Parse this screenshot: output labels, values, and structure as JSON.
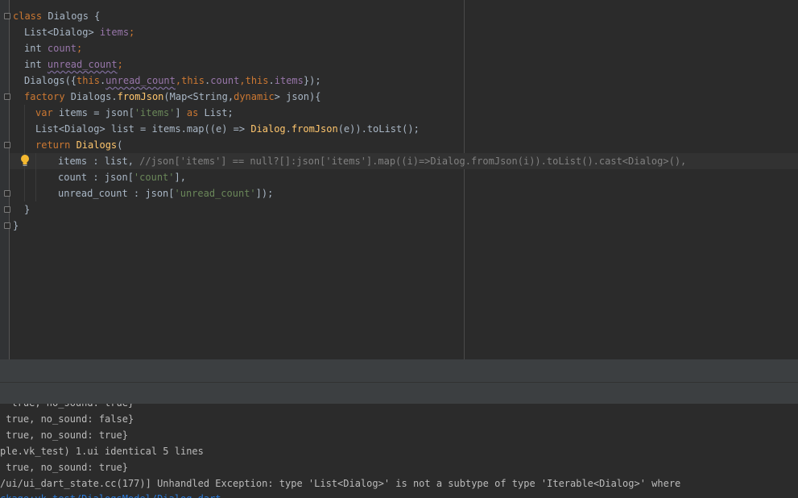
{
  "editor": {
    "code_lines": [
      [
        "class",
        " Dialogs {"
      ],
      [
        "List<Dialog> ",
        "items",
        ";"
      ],
      [
        "int ",
        "count",
        ";"
      ],
      [
        "int ",
        "unread_count",
        ";"
      ],
      [
        "Dialogs({",
        "this",
        ".",
        "unread_count",
        ",",
        "this",
        ".",
        "count",
        ",",
        "this",
        ".",
        "items",
        "});"
      ],
      [
        "factory ",
        "Dialogs.",
        "fromJson",
        "(Map<String,",
        "dynamic",
        "> json){"
      ],
      [
        "var ",
        "items = json[",
        "'items'",
        "] ",
        "as ",
        "List;"
      ],
      [
        "List<Dialog> list = items.map((e) => ",
        "Dialog",
        ".",
        "fromJson",
        "(e)).toList();"
      ],
      [
        "return ",
        "Dialogs",
        "("
      ],
      [
        "items : list, ",
        "//json['items'] == null?[]:json['items'].map((i)=>Dialog.fromJson(i)).toList().cast<Dialog>(),"
      ],
      [
        "count : json[",
        "'count'",
        "],"
      ],
      [
        "unread_count : json[",
        "'unread_count'",
        "]);"
      ],
      [
        "}"
      ],
      [
        "}"
      ]
    ],
    "icons": {
      "bulb": "lightbulb-icon",
      "fold": "fold-marker-icon"
    }
  },
  "console": {
    "lines": [
      "  true, no_sound: true}",
      " true, no_sound: false}",
      " true, no_sound: true}",
      "ple.vk_test) 1.ui identical 5 lines",
      " true, no_sound: true}",
      "/ui/ui_dart_state.cc(177)] Unhandled Exception: type 'List<Dialog>' is not a subtype of type 'Iterable<Dialog>' where",
      "ckage:vk_test/DialogsModel/Dialog.dart"
    ]
  },
  "colors": {
    "editor_bg": "#2b2b2b",
    "keyword": "#cc7832",
    "function": "#ffc66d",
    "field": "#9876aa",
    "string": "#6a8759",
    "comment": "#808080",
    "text": "#a9b7c6",
    "panel": "#3c3f41"
  }
}
